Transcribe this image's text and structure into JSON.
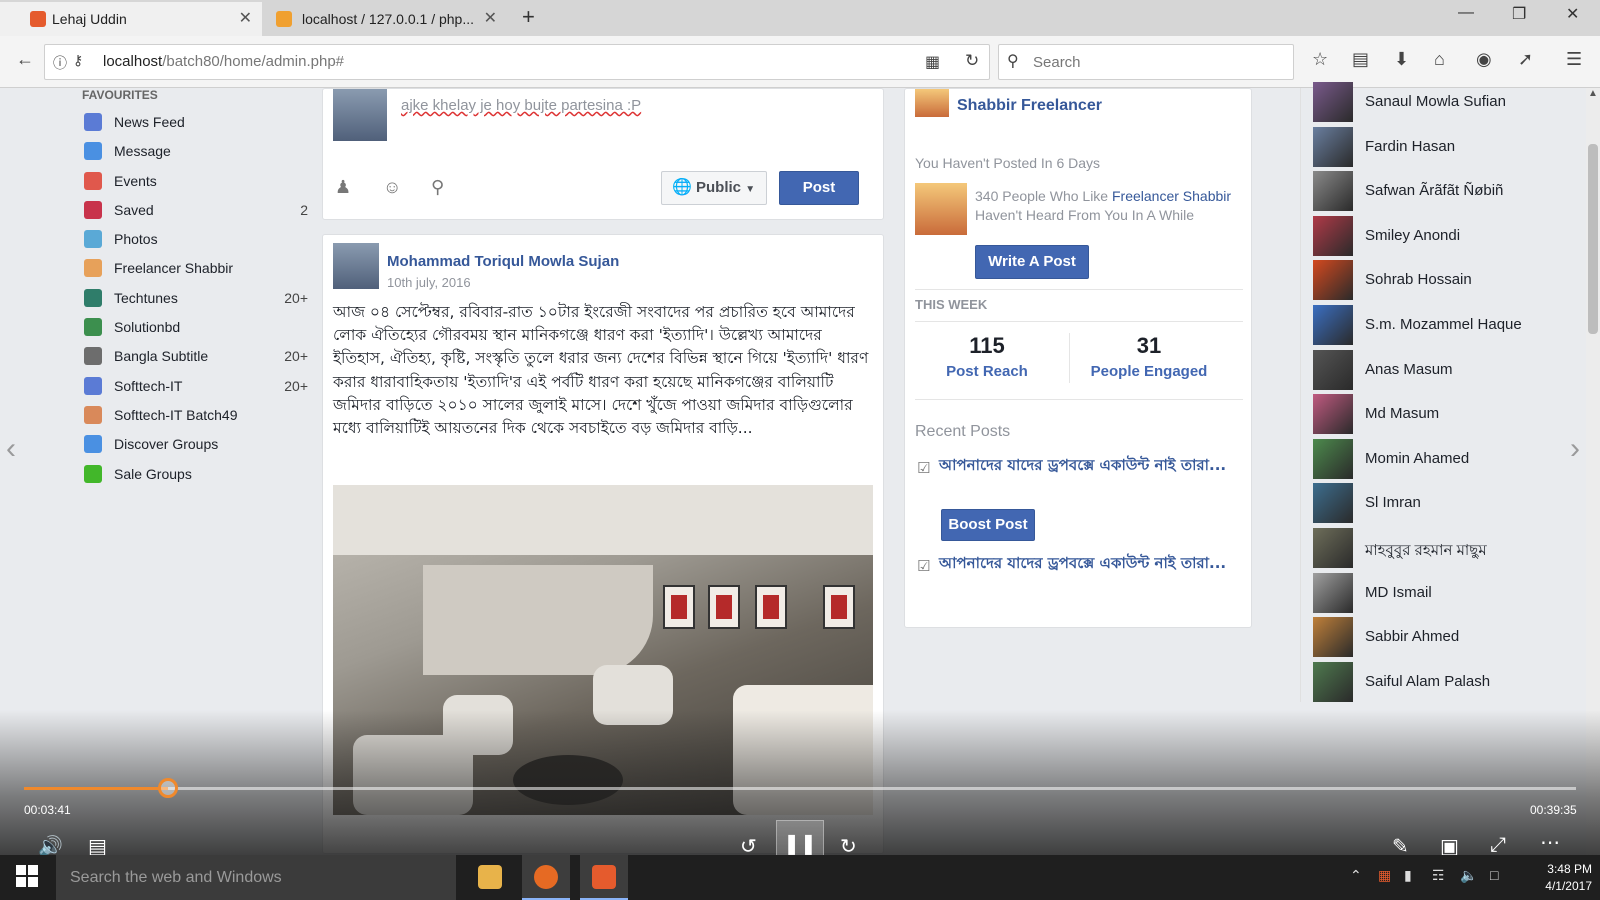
{
  "browser": {
    "tabs": [
      {
        "label": "Lehaj Uddin",
        "color": "#e55b2d"
      },
      {
        "label": "localhost / 127.0.0.1 / php...",
        "color": "#f0a030"
      }
    ],
    "url_host": "localhost",
    "url_path": "/batch80/home/admin.php#",
    "search_placeholder": "Search"
  },
  "favourites": {
    "title": "FAVOURITES",
    "items": [
      {
        "label": "News Feed",
        "count": "",
        "color": "#5b7bd5"
      },
      {
        "label": "Message",
        "count": "",
        "color": "#4a90e2"
      },
      {
        "label": "Events",
        "count": "",
        "color": "#e0584c"
      },
      {
        "label": "Saved",
        "count": "2",
        "color": "#c8334b"
      },
      {
        "label": "Photos",
        "count": "",
        "color": "#5aa9d6"
      },
      {
        "label": "Freelancer Shabbir",
        "count": "",
        "color": "#e7a15a"
      },
      {
        "label": "Techtunes",
        "count": "20+",
        "color": "#2f7d6a"
      },
      {
        "label": "Solutionbd",
        "count": "",
        "color": "#3c8f4e"
      },
      {
        "label": "Bangla Subtitle",
        "count": "20+",
        "color": "#6d6d6d"
      },
      {
        "label": "Softtech-IT",
        "count": "20+",
        "color": "#5b7bd5"
      },
      {
        "label": "Softtech-IT Batch49",
        "count": "",
        "color": "#d9895a"
      },
      {
        "label": "Discover Groups",
        "count": "",
        "color": "#4a90e2"
      },
      {
        "label": "Sale Groups",
        "count": "",
        "color": "#42b72a"
      }
    ]
  },
  "composer": {
    "text": "ajke khelay je hoy bujte partesina :P",
    "privacy": "Public",
    "post_label": "Post"
  },
  "post": {
    "author": "Mohammad Toriqul Mowla Sujan",
    "date": "10th july, 2016",
    "body": "আজ ০৪ সেপ্টেম্বর, রবিবার-রাত ১০টার ইংরেজী সংবাদের পর প্রচারিত হবে আমাদের লোক ঐতিহ্যের গৌরবময় স্থান মানিকগঞ্জে ধারণ করা 'ইত্যাদি'। উল্লেখ্য আমাদের ইতিহাস, ঐতিহ্য, কৃষ্টি, সংস্কৃতি তুলে ধরার জন্য দেশের বিভিন্ন স্থানে গিয়ে 'ইত্যাদি' ধারণ করার ধারাবাহিকতায় 'ইত্যাদি'র এই পর্বটি ধারণ করা হয়েছে মানিকগঞ্জের বালিয়াটি জমিদার বাড়িতে ২০১০ সালের জুলাই মাসে। দেশে খুঁজে পাওয়া জমিদার বাড়িগুলোর মধ্যে বালিয়াটিই আয়তনের দিক থেকে সবচাইতে বড় জমিদার বাড়ি..."
  },
  "page_card": {
    "name": "Shabbir Freelancer",
    "not_posted": "You Haven't Posted In 6 Days",
    "notice_prefix": "340 People Who Like ",
    "notice_link": "Freelancer Shabbir",
    "notice_suffix": " Haven't Heard From You In A While",
    "write_post": "Write A Post",
    "this_week": "THIS WEEK",
    "post_reach_value": "115",
    "post_reach_label": "Post Reach",
    "engaged_value": "31",
    "engaged_label": "People Engaged",
    "recent_posts": "Recent Posts",
    "recent_1": "আপনাদের যাদের ড্রপবক্সে একাউন্ট নাই তারা...",
    "recent_2": "আপনাদের যাদের ড্রপবক্সে একাউন্ট নাই তারা...",
    "boost_post": "Boost Post"
  },
  "chat": [
    {
      "name": "Sanaul Mowla Sufian",
      "color": "#7a5a8c"
    },
    {
      "name": "Fardin Hasan",
      "color": "#6a7fa0"
    },
    {
      "name": "Safwan Ãrãfãt Ñøbiñ",
      "color": "#8a8a8a"
    },
    {
      "name": "Smiley Anondi",
      "color": "#b03a48"
    },
    {
      "name": "Sohrab Hossain",
      "color": "#d4491f"
    },
    {
      "name": "S.m. Mozammel Haque",
      "color": "#3b6fc2"
    },
    {
      "name": "Anas Masum",
      "color": "#555555"
    },
    {
      "name": "Md Masum",
      "color": "#c05a80"
    },
    {
      "name": "Momin Ahamed",
      "color": "#4d8a4d"
    },
    {
      "name": "Sl Imran",
      "color": "#3d6e8f"
    },
    {
      "name": "মাহবুবুর রহমান মাছুম",
      "color": "#6e6e5a"
    },
    {
      "name": "MD Ismail",
      "color": "#a0a0a0"
    },
    {
      "name": "Sabbir Ahmed",
      "color": "#c0803a"
    },
    {
      "name": "Saiful Alam Palash",
      "color": "#4f7a4f"
    }
  ],
  "player": {
    "elapsed": "00:03:41",
    "total": "00:39:35",
    "progress": 0.093,
    "accent": "#f0892c"
  },
  "taskbar": {
    "search_placeholder": "Search the web and Windows",
    "time": "3:48 PM",
    "date": "4/1/2017"
  }
}
